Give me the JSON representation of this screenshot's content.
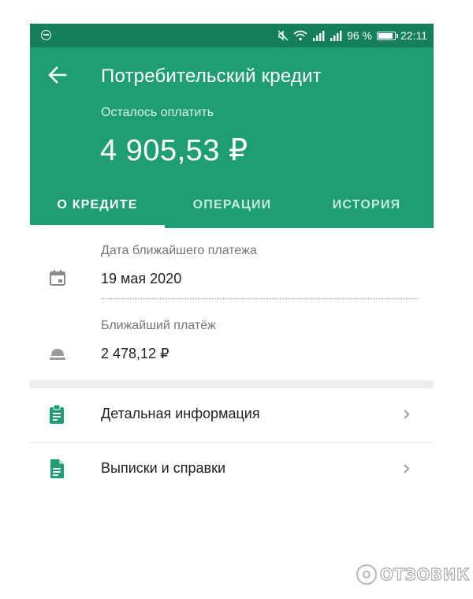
{
  "status_bar": {
    "battery_percent": "96 %",
    "battery_level": 0.96,
    "time": "22:11",
    "icons": [
      "notification-icon",
      "mute-icon",
      "wifi-icon",
      "signal-icon",
      "signal-icon",
      "battery-icon"
    ]
  },
  "header": {
    "title": "Потребительский кредит",
    "subtitle": "Осталось оплатить",
    "amount": "4 905,53 ₽"
  },
  "tabs": [
    {
      "label": "О КРЕДИТЕ",
      "active": true
    },
    {
      "label": "ОПЕРАЦИИ",
      "active": false
    },
    {
      "label": "ИСТОРИЯ",
      "active": false
    }
  ],
  "details": {
    "next_date_label": "Дата ближайшего платежа",
    "next_date_value": "19 мая 2020",
    "next_payment_label": "Ближайший платёж",
    "next_payment_value": "2 478,12 ₽"
  },
  "menu": [
    {
      "label": "Детальная информация",
      "icon": "clipboard-icon"
    },
    {
      "label": "Выписки и справки",
      "icon": "document-icon"
    }
  ],
  "colors": {
    "header": "#1f9e74",
    "status_bar": "#13805b",
    "icon_green": "#1f9e74"
  },
  "watermark": {
    "text": "ОТЗОВИК"
  }
}
